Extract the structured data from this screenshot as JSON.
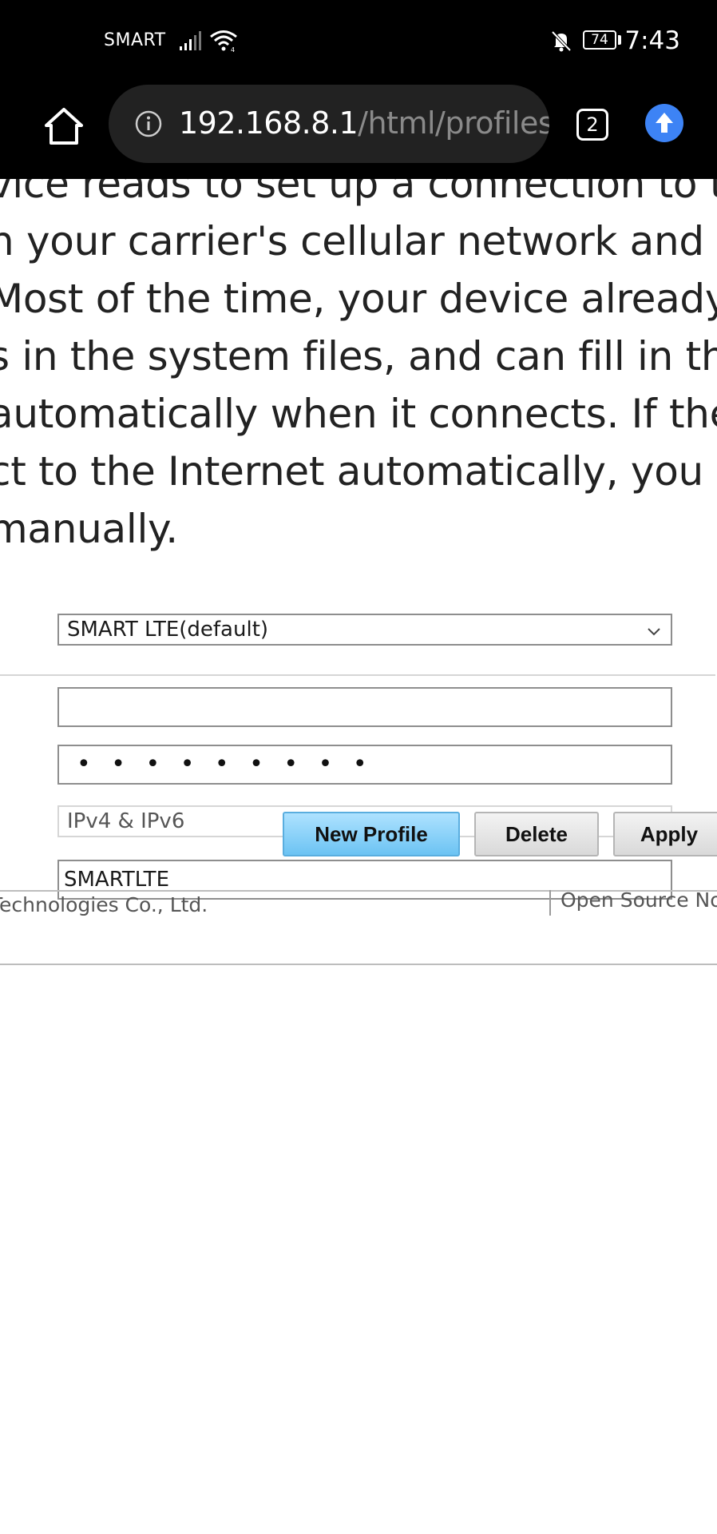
{
  "status_bar": {
    "carrier": "SMART",
    "battery_level": "74",
    "time": "7:43",
    "icons": [
      "signal-icon",
      "wifi-icon",
      "mute-bell-icon",
      "battery-icon"
    ]
  },
  "browser": {
    "url_host": "192.168.8.1",
    "url_path": "/html/profiles",
    "tab_count": "2",
    "icons": [
      "home-icon",
      "info-icon",
      "tabs-icon",
      "update-arrow-icon"
    ],
    "accent_color": "#3d83f5"
  },
  "description": {
    "lines": [
      "vice reads to set up a connection to the",
      "n your carrier's cellular network and th",
      "Most of the time, your device already",
      "s in the system files, and can fill in the",
      "automatically when it connects. If the",
      "ct to the Internet automatically, you ca",
      "manually."
    ]
  },
  "form": {
    "profile_select_value": "SMART LTE(default)",
    "username_value": "",
    "password_mask": "• • • • • • • • •",
    "ip_type_value": "IPv4 & IPv6",
    "apn_value": "SMARTLTE"
  },
  "buttons": {
    "new_profile": "New Profile",
    "delete": "Delete",
    "apply": "Apply",
    "primary_color": "#6cc3f3"
  },
  "footer": {
    "copyright": "Technologies Co., Ltd.",
    "open_source": "Open Source No"
  }
}
